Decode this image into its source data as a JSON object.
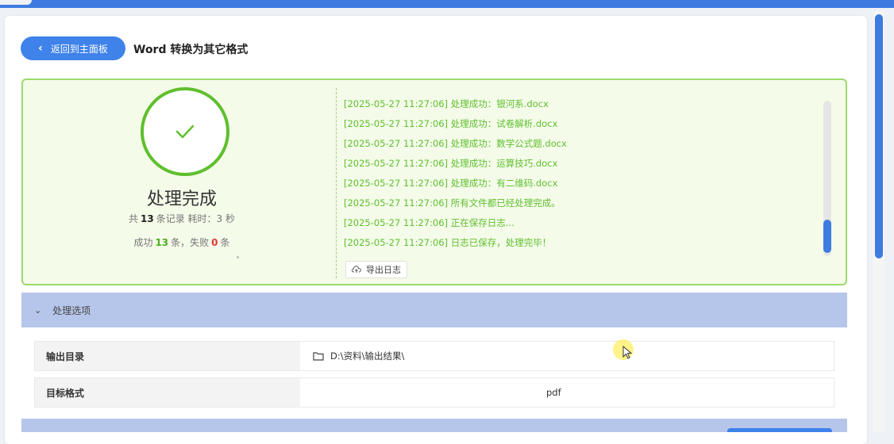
{
  "header": {
    "back_label": "返回到主面板",
    "title": "Word 转换为其它格式"
  },
  "result": {
    "status_title": "处理完成",
    "stats_line1": {
      "prefix": "共",
      "total": "13",
      "mid": "条记录  耗时：3 秒"
    },
    "stats_line2": {
      "prefix": "成功",
      "success": "13",
      "mid": "条，失败",
      "failed": "0",
      "suffix": "条"
    },
    "export_label": "导出日志"
  },
  "log": [
    "[2025-05-27 11:27:06] 处理成功：银河系.docx",
    "[2025-05-27 11:27:06] 处理成功：试卷解析.docx",
    "[2025-05-27 11:27:06] 处理成功：数学公式题.docx",
    "[2025-05-27 11:27:06] 处理成功：运算技巧.docx",
    "[2025-05-27 11:27:06] 处理成功：有二维码.docx",
    "[2025-05-27 11:27:06] 所有文件都已经处理完成。",
    "[2025-05-27 11:27:06] 正在保存日志...",
    "[2025-05-27 11:27:06] 日志已保存，处理完毕！"
  ],
  "options": {
    "header_label": "处理选项",
    "output_dir_label": "输出目录",
    "output_dir_value": "D:\\资料\\输出结果\\",
    "target_format_label": "目标格式",
    "target_format_value": "pdf"
  },
  "colors": {
    "accent": "#3e82ea",
    "success": "#5fbf2e",
    "panel_bg": "#f4fbe9",
    "options_header": "#b6c6ea"
  }
}
